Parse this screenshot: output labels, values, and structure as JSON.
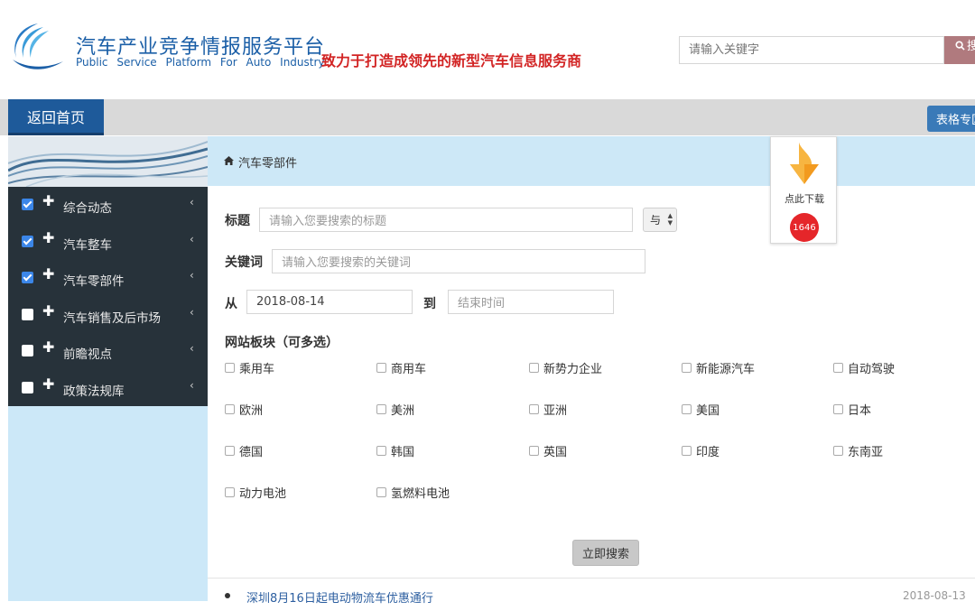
{
  "header": {
    "logo_title": "汽车产业竞争情报服务平台",
    "logo_subtitle": "Public Service Platform For Auto Industry",
    "slogan": "致力于打造成领先的新型汽车信息服务商",
    "search_placeholder": "请输入关键字",
    "search_button": "搜索",
    "search_icon": "search-icon",
    "brand_color": "#1b5fa7",
    "slogan_color": "#d22424"
  },
  "nav": {
    "home_label": "返回首页",
    "table_label": "表格专区",
    "home_color": "#1e5a9a"
  },
  "sidebar": {
    "items": [
      {
        "label": "综合动态",
        "checked": true
      },
      {
        "label": "汽车整车",
        "checked": true
      },
      {
        "label": "汽车零部件",
        "checked": true
      },
      {
        "label": "汽车销售及后市场",
        "checked": false
      },
      {
        "label": "前瞻视点",
        "checked": false
      },
      {
        "label": "政策法规库",
        "checked": false
      }
    ],
    "plus_glyph": "✚",
    "chevron_glyph": "‹"
  },
  "breadcrumb": {
    "icon": "home-icon",
    "current": "汽车零部件"
  },
  "form": {
    "title_label": "标题",
    "title_placeholder": "请输入您要搜索的标题",
    "and_select_value": "与",
    "keyword_label": "关键词",
    "keyword_placeholder": "请输入您要搜索的关键词",
    "from_label": "从",
    "from_value": "2018-08-14",
    "to_label": "到",
    "to_placeholder": "结束时间",
    "sections_label": "网站板块（可多选）",
    "sections": [
      [
        "乘用车",
        "商用车",
        "新势力企业",
        "新能源汽车",
        "自动驾驶"
      ],
      [
        "欧洲",
        "美洲",
        "亚洲",
        "美国",
        "日本"
      ],
      [
        "德国",
        "韩国",
        "英国",
        "印度",
        "东南亚"
      ],
      [
        "动力电池",
        "氢燃料电池"
      ]
    ],
    "search_now": "立即搜索"
  },
  "download": {
    "label": "点此下载",
    "count": "1646",
    "icon": "download-arrow-icon"
  },
  "results": [
    {
      "title": "深圳8月16日起电动物流车优惠通行",
      "date": "2018-08-13"
    }
  ]
}
